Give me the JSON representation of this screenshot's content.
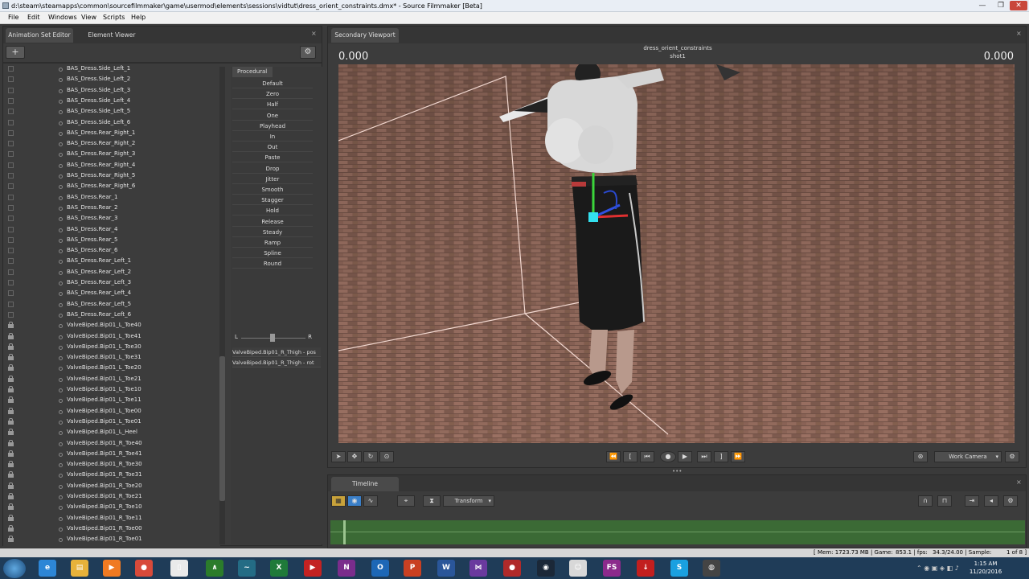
{
  "window": {
    "title": "d:\\steam\\steamapps\\common\\sourcefilmmaker\\game\\usermod\\elements\\sessions\\vidtut\\dress_orient_constraints.dmx* - Source Filmmaker [Beta]"
  },
  "menu": [
    "File",
    "Edit",
    "Windows",
    "View",
    "Scripts",
    "Help"
  ],
  "left_panel": {
    "tabs": [
      "Animation Set Editor",
      "Element Viewer"
    ],
    "tree_rows": [
      {
        "label": "BAS_Dress.Side_Left_1",
        "locked": false
      },
      {
        "label": "BAS_Dress.Side_Left_2",
        "locked": false
      },
      {
        "label": "BAS_Dress.Side_Left_3",
        "locked": false
      },
      {
        "label": "BAS_Dress.Side_Left_4",
        "locked": false
      },
      {
        "label": "BAS_Dress.Side_Left_5",
        "locked": false
      },
      {
        "label": "BAS_Dress.Side_Left_6",
        "locked": false
      },
      {
        "label": "BAS_Dress.Rear_Right_1",
        "locked": false
      },
      {
        "label": "BAS_Dress.Rear_Right_2",
        "locked": false
      },
      {
        "label": "BAS_Dress.Rear_Right_3",
        "locked": false
      },
      {
        "label": "BAS_Dress.Rear_Right_4",
        "locked": false
      },
      {
        "label": "BAS_Dress.Rear_Right_5",
        "locked": false
      },
      {
        "label": "BAS_Dress.Rear_Right_6",
        "locked": false
      },
      {
        "label": "BAS_Dress.Rear_1",
        "locked": false
      },
      {
        "label": "BAS_Dress.Rear_2",
        "locked": false
      },
      {
        "label": "BAS_Dress.Rear_3",
        "locked": false
      },
      {
        "label": "BAS_Dress.Rear_4",
        "locked": false
      },
      {
        "label": "BAS_Dress.Rear_5",
        "locked": false
      },
      {
        "label": "BAS_Dress.Rear_6",
        "locked": false
      },
      {
        "label": "BAS_Dress.Rear_Left_1",
        "locked": false
      },
      {
        "label": "BAS_Dress.Rear_Left_2",
        "locked": false
      },
      {
        "label": "BAS_Dress.Rear_Left_3",
        "locked": false
      },
      {
        "label": "BAS_Dress.Rear_Left_4",
        "locked": false
      },
      {
        "label": "BAS_Dress.Rear_Left_5",
        "locked": false
      },
      {
        "label": "BAS_Dress.Rear_Left_6",
        "locked": false
      },
      {
        "label": "ValveBiped.Bip01_L_Toe40",
        "locked": true
      },
      {
        "label": "ValveBiped.Bip01_L_Toe41",
        "locked": true
      },
      {
        "label": "ValveBiped.Bip01_L_Toe30",
        "locked": true
      },
      {
        "label": "ValveBiped.Bip01_L_Toe31",
        "locked": true
      },
      {
        "label": "ValveBiped.Bip01_L_Toe20",
        "locked": true
      },
      {
        "label": "ValveBiped.Bip01_L_Toe21",
        "locked": true
      },
      {
        "label": "ValveBiped.Bip01_L_Toe10",
        "locked": true
      },
      {
        "label": "ValveBiped.Bip01_L_Toe11",
        "locked": true
      },
      {
        "label": "ValveBiped.Bip01_L_Toe00",
        "locked": true
      },
      {
        "label": "ValveBiped.Bip01_L_Toe01",
        "locked": true
      },
      {
        "label": "ValveBiped.Bip01_L_Heel",
        "locked": true
      },
      {
        "label": "ValveBiped.Bip01_R_Toe40",
        "locked": true
      },
      {
        "label": "ValveBiped.Bip01_R_Toe41",
        "locked": true
      },
      {
        "label": "ValveBiped.Bip01_R_Toe30",
        "locked": true
      },
      {
        "label": "ValveBiped.Bip01_R_Toe31",
        "locked": true
      },
      {
        "label": "ValveBiped.Bip01_R_Toe20",
        "locked": true
      },
      {
        "label": "ValveBiped.Bip01_R_Toe21",
        "locked": true
      },
      {
        "label": "ValveBiped.Bip01_R_Toe10",
        "locked": true
      },
      {
        "label": "ValveBiped.Bip01_R_Toe11",
        "locked": true
      },
      {
        "label": "ValveBiped.Bip01_R_Toe00",
        "locked": true
      },
      {
        "label": "ValveBiped.Bip01_R_Toe01",
        "locked": true
      }
    ],
    "procedural": {
      "tab": "Procedural",
      "items": [
        "Default",
        "Zero",
        "Half",
        "One",
        "Playhead",
        "In",
        "Out",
        "Paste",
        "Drop",
        "Jitter",
        "Smooth",
        "Stagger",
        "Hold",
        "Release",
        "Steady",
        "Ramp",
        "Spline",
        "Round"
      ],
      "slider_left": "L",
      "slider_right": "R",
      "attributes": [
        "ValveBiped.Bip01_R_Thigh - pos",
        "ValveBiped.Bip01_R_Thigh - rot"
      ]
    }
  },
  "viewport": {
    "tab": "Secondary Viewport",
    "left_value": "0.000",
    "right_value": "0.000",
    "scene_name": "dress_orient_constraints",
    "shot_name": "shot1",
    "camera_select": "Work Camera"
  },
  "timeline": {
    "tab": "Timeline",
    "mode_select": "Transform"
  },
  "status": {
    "mem": "[ Mem: 1723.73 MB | Game:",
    "game": "853.1 | fps:",
    "fps": "34.3/24.00 | Sample:",
    "page": "1 of 8 ]"
  },
  "taskbar": {
    "time": "1:15 AM",
    "date": "11/20/2016",
    "icons": [
      {
        "name": "ie-icon",
        "color": "#2d86d6",
        "glyph": "e"
      },
      {
        "name": "explorer-icon",
        "color": "#e7b23a",
        "glyph": "▤"
      },
      {
        "name": "media-player-icon",
        "color": "#f07a22",
        "glyph": "▶"
      },
      {
        "name": "chrome-icon",
        "color": "#d84a3a",
        "glyph": "●"
      },
      {
        "name": "notepad-icon",
        "color": "#eaeaea",
        "glyph": "▯"
      },
      {
        "name": "app-green-icon",
        "color": "#2b7c2b",
        "glyph": "∧"
      },
      {
        "name": "app-bird-icon",
        "color": "#246c85",
        "glyph": "~"
      },
      {
        "name": "excel-icon",
        "color": "#1f7a3a",
        "glyph": "X"
      },
      {
        "name": "mp3-icon",
        "color": "#c32222",
        "glyph": "▶"
      },
      {
        "name": "onenote-icon",
        "color": "#7a2d8c",
        "glyph": "N"
      },
      {
        "name": "outlook-icon",
        "color": "#1d67b6",
        "glyph": "O"
      },
      {
        "name": "powerpoint-icon",
        "color": "#c94022",
        "glyph": "P"
      },
      {
        "name": "word-icon",
        "color": "#2a5699",
        "glyph": "W"
      },
      {
        "name": "visual-studio-icon",
        "color": "#6a3a9e",
        "glyph": "⋈"
      },
      {
        "name": "game-icon",
        "color": "#b02a2a",
        "glyph": "●"
      },
      {
        "name": "steam-icon",
        "color": "#1b2838",
        "glyph": "◉"
      },
      {
        "name": "sfm-icon",
        "color": "#d8d8d8",
        "glyph": "☺"
      },
      {
        "name": "fs-icon",
        "color": "#8c2a8c",
        "glyph": "FS"
      },
      {
        "name": "download-icon",
        "color": "#c21f1f",
        "glyph": "↓"
      },
      {
        "name": "skype-icon",
        "color": "#1aa0e0",
        "glyph": "S"
      },
      {
        "name": "app-ball-icon",
        "color": "#444444",
        "glyph": "◍"
      }
    ]
  }
}
